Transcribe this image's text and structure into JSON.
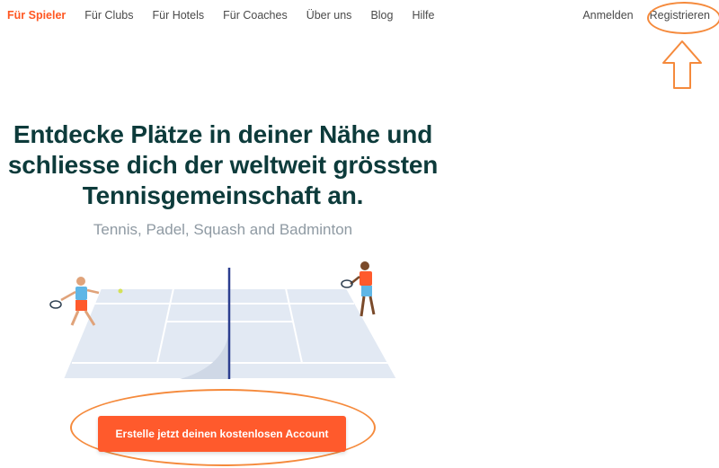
{
  "nav": {
    "items": [
      {
        "label": "Für Spieler",
        "active": true
      },
      {
        "label": "Für Clubs"
      },
      {
        "label": "Für Hotels"
      },
      {
        "label": "Für Coaches"
      },
      {
        "label": "Über uns"
      },
      {
        "label": "Blog"
      },
      {
        "label": "Hilfe"
      }
    ],
    "login": "Anmelden",
    "register": "Registrieren"
  },
  "hero": {
    "title_line1": "Entdecke Plätze in deiner Nähe und",
    "title_line2": "schliesse dich der weltweit grössten",
    "title_line3": "Tennisgemeinschaft an.",
    "subtitle": "Tennis, Padel, Squash and Badminton"
  },
  "cta": {
    "label": "Erstelle jetzt deinen kostenlosen Account"
  },
  "colors": {
    "accent": "#ff5a2c",
    "annotation": "#f58a3c",
    "title": "#0d3b3b"
  },
  "icons": {
    "illustration": "tennis-court-illustration",
    "arrow": "up-arrow-annotation"
  }
}
